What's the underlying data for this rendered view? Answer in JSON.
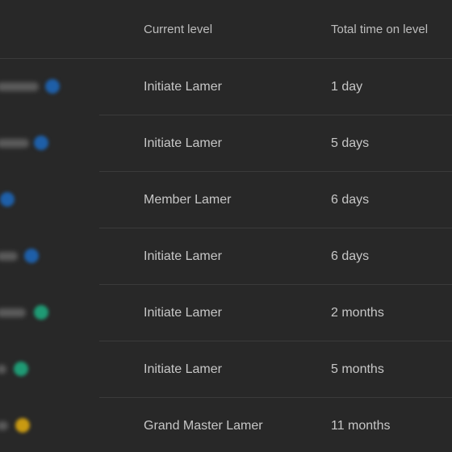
{
  "header": {
    "current_level": "Current level",
    "total_time": "Total time on level"
  },
  "members": [
    {
      "level": "Initiate Lamer",
      "time": "1 day",
      "badge_color": "#1e5fa8"
    },
    {
      "level": "Initiate Lamer",
      "time": "5 days",
      "badge_color": "#1e5fa8"
    },
    {
      "level": "Member Lamer",
      "time": "6 days",
      "badge_color": "#1e5fa8"
    },
    {
      "level": "Initiate Lamer",
      "time": "6 days",
      "badge_color": "#1e5fa8"
    },
    {
      "level": "Initiate Lamer",
      "time": "2 months",
      "badge_color": "#1f9a74"
    },
    {
      "level": "Initiate Lamer",
      "time": "5 months",
      "badge_color": "#1f9a74"
    },
    {
      "level": "Grand Master Lamer",
      "time": "11 months",
      "badge_color": "#c99a12"
    }
  ]
}
